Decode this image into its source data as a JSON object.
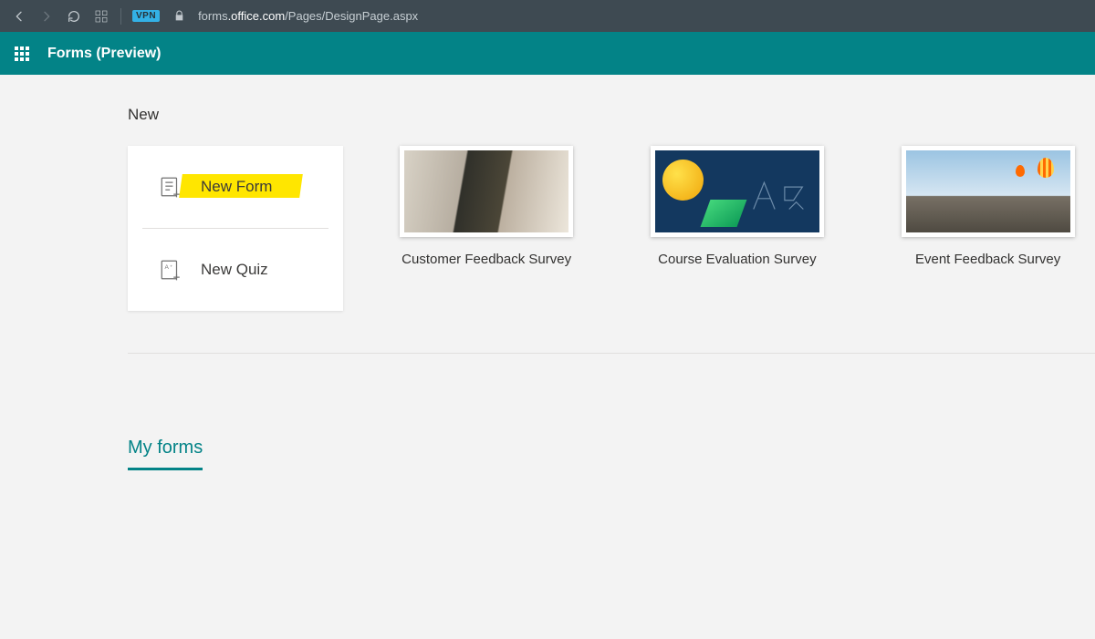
{
  "browser": {
    "vpn_label": "VPN",
    "url_pre": "forms",
    "url_domain": ".office.com",
    "url_path": "/Pages/DesignPage.aspx"
  },
  "header": {
    "app_title": "Forms (Preview)"
  },
  "new_section": {
    "label": "New",
    "new_form_label": "New Form",
    "new_quiz_label": "New Quiz"
  },
  "templates": [
    {
      "label": "Customer Feedback Survey"
    },
    {
      "label": "Course Evaluation Survey"
    },
    {
      "label": "Event Feedback Survey"
    }
  ],
  "tabs": {
    "my_forms": "My forms"
  }
}
